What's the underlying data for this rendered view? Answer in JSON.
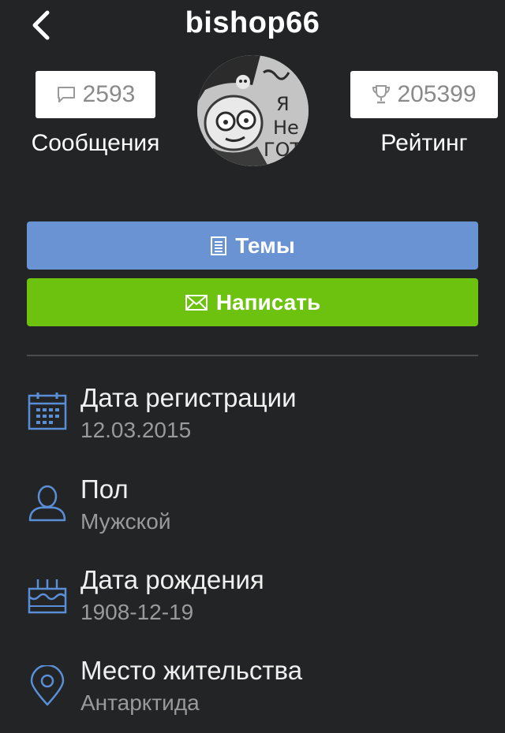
{
  "header": {
    "title": "bishop66",
    "back_icon": "chevron-left-icon"
  },
  "stats": {
    "messages": {
      "value": "2593",
      "label": "Сообщения",
      "icon": "comment-icon"
    },
    "rating": {
      "value": "205399",
      "label": "Рейтинг",
      "icon": "trophy-icon"
    }
  },
  "avatar": {
    "text_lines": [
      "Я",
      "Не",
      "ГОТ"
    ]
  },
  "buttons": {
    "topics": {
      "label": "Темы",
      "icon": "document-icon",
      "color": "#6a93d3"
    },
    "write": {
      "label": "Написать",
      "icon": "envelope-icon",
      "color": "#6cc20f"
    }
  },
  "info": [
    {
      "label": "Дата регистрации",
      "value": "12.03.2015",
      "icon": "calendar-icon"
    },
    {
      "label": "Пол",
      "value": "Мужской",
      "icon": "user-icon"
    },
    {
      "label": "Дата рождения",
      "value": "1908-12-19",
      "icon": "birthday-cake-icon"
    },
    {
      "label": "Место жительства",
      "value": "Антарктида",
      "icon": "map-pin-icon"
    }
  ],
  "colors": {
    "background": "#232425",
    "icon_accent": "#5a8fd8"
  }
}
